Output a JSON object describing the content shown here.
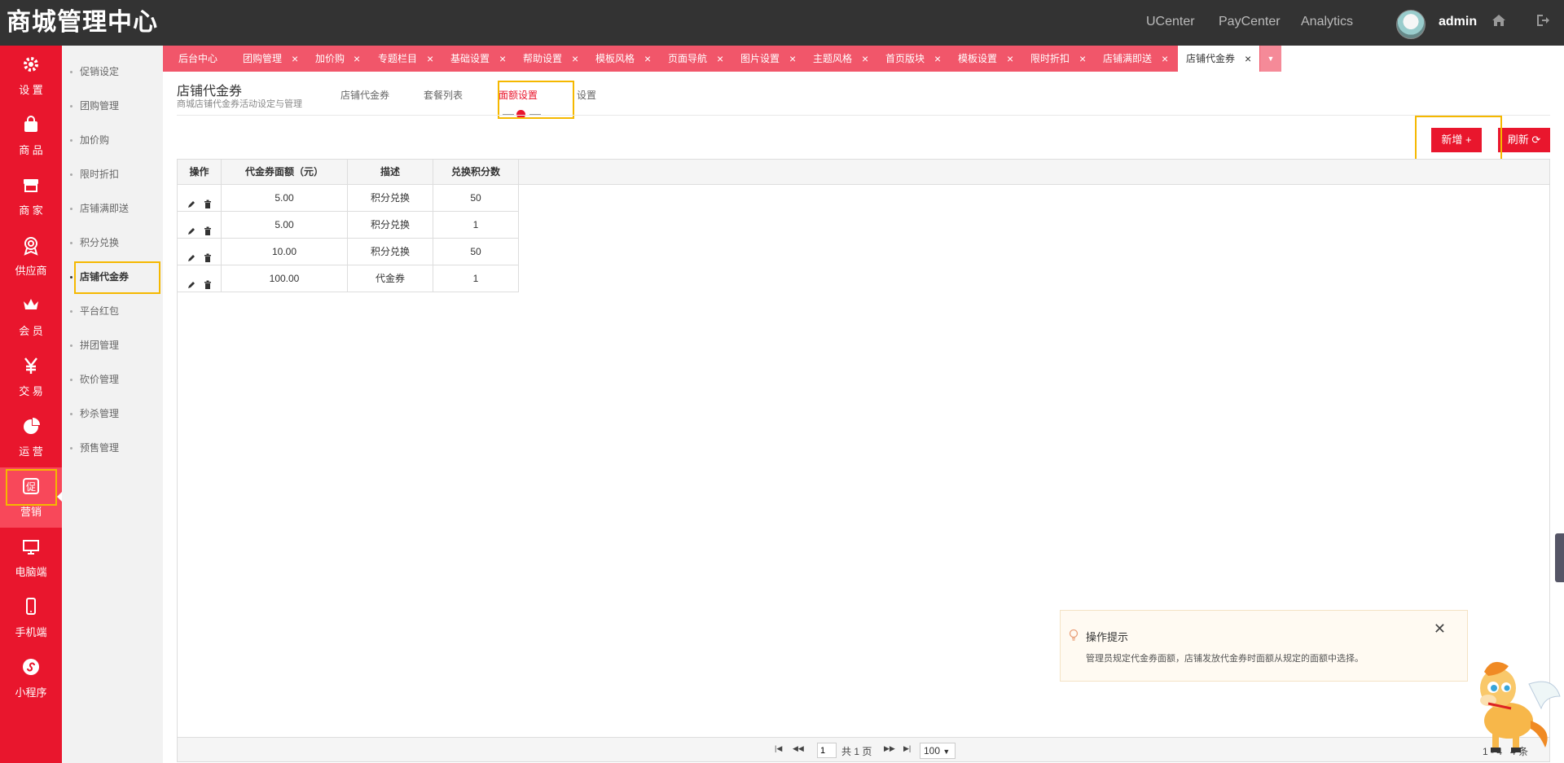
{
  "header": {
    "brand": "商城管理中心",
    "nav": [
      "UCenter",
      "PayCenter",
      "Analytics"
    ],
    "user": "admin"
  },
  "leftnav": [
    {
      "label": "设 置",
      "icon": "gear-icon"
    },
    {
      "label": "商 品",
      "icon": "shopping-bag-icon"
    },
    {
      "label": "商 家",
      "icon": "store-icon"
    },
    {
      "label": "供应商",
      "icon": "badge-icon"
    },
    {
      "label": "会 员",
      "icon": "crown-icon"
    },
    {
      "label": "交 易",
      "icon": "yen-icon"
    },
    {
      "label": "运 营",
      "icon": "pie-chart-icon"
    },
    {
      "label": "营销",
      "icon": "promo-icon"
    },
    {
      "label": "电脑端",
      "icon": "monitor-icon"
    },
    {
      "label": "手机端",
      "icon": "mobile-icon"
    },
    {
      "label": "小程序",
      "icon": "miniprogram-icon"
    }
  ],
  "submenu": [
    "促销设定",
    "团购管理",
    "加价购",
    "限时折扣",
    "店铺满即送",
    "积分兑换",
    "店铺代金券",
    "平台红包",
    "拼团管理",
    "砍价管理",
    "秒杀管理",
    "预售管理"
  ],
  "tabs": [
    "后台中心",
    "团购管理",
    "加价购",
    "专题栏目",
    "基础设置",
    "帮助设置",
    "模板风格",
    "页面导航",
    "图片设置",
    "主题风格",
    "首页版块",
    "模板设置",
    "限时折扣",
    "店铺满即送",
    "店铺代金券"
  ],
  "page": {
    "title": "店铺代金券",
    "subtitle": "商城店铺代金券活动设定与管理",
    "tabs": [
      "店铺代金券",
      "套餐列表",
      "面额设置",
      "设置"
    ]
  },
  "buttons": {
    "add": "新增 +",
    "refresh": "刷新 ⟳"
  },
  "table": {
    "columns": [
      "操作",
      "代金券面额（元）",
      "描述",
      "兑换积分数"
    ],
    "rows": [
      [
        "5.00",
        "积分兑换",
        "50"
      ],
      [
        "5.00",
        "积分兑换",
        "1"
      ],
      [
        "10.00",
        "积分兑换",
        "50"
      ],
      [
        "100.00",
        "代金券",
        "1"
      ]
    ]
  },
  "pager": {
    "page": "1",
    "total_pages": "共 1 页",
    "page_size": "100",
    "summary": "1 - 4   4 条"
  },
  "tip": {
    "title": "操作提示",
    "body": "管理员规定代金券面额，店铺发放代金券时面额从规定的面额中选择。"
  }
}
